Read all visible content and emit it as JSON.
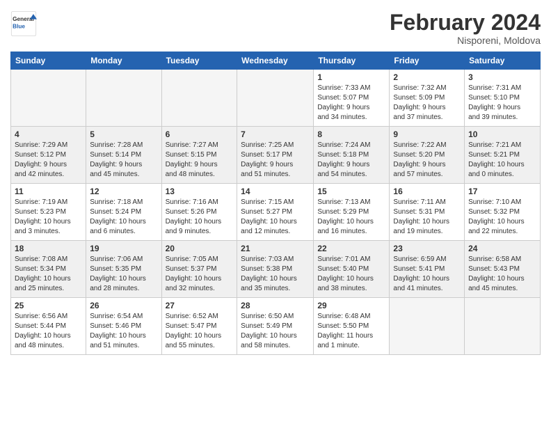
{
  "logo": {
    "text_general": "General",
    "text_blue": "Blue"
  },
  "title": "February 2024",
  "subtitle": "Nisporeni, Moldova",
  "weekdays": [
    "Sunday",
    "Monday",
    "Tuesday",
    "Wednesday",
    "Thursday",
    "Friday",
    "Saturday"
  ],
  "weeks": [
    [
      {
        "day": "",
        "info": ""
      },
      {
        "day": "",
        "info": ""
      },
      {
        "day": "",
        "info": ""
      },
      {
        "day": "",
        "info": ""
      },
      {
        "day": "1",
        "info": "Sunrise: 7:33 AM\nSunset: 5:07 PM\nDaylight: 9 hours\nand 34 minutes."
      },
      {
        "day": "2",
        "info": "Sunrise: 7:32 AM\nSunset: 5:09 PM\nDaylight: 9 hours\nand 37 minutes."
      },
      {
        "day": "3",
        "info": "Sunrise: 7:31 AM\nSunset: 5:10 PM\nDaylight: 9 hours\nand 39 minutes."
      }
    ],
    [
      {
        "day": "4",
        "info": "Sunrise: 7:29 AM\nSunset: 5:12 PM\nDaylight: 9 hours\nand 42 minutes."
      },
      {
        "day": "5",
        "info": "Sunrise: 7:28 AM\nSunset: 5:14 PM\nDaylight: 9 hours\nand 45 minutes."
      },
      {
        "day": "6",
        "info": "Sunrise: 7:27 AM\nSunset: 5:15 PM\nDaylight: 9 hours\nand 48 minutes."
      },
      {
        "day": "7",
        "info": "Sunrise: 7:25 AM\nSunset: 5:17 PM\nDaylight: 9 hours\nand 51 minutes."
      },
      {
        "day": "8",
        "info": "Sunrise: 7:24 AM\nSunset: 5:18 PM\nDaylight: 9 hours\nand 54 minutes."
      },
      {
        "day": "9",
        "info": "Sunrise: 7:22 AM\nSunset: 5:20 PM\nDaylight: 9 hours\nand 57 minutes."
      },
      {
        "day": "10",
        "info": "Sunrise: 7:21 AM\nSunset: 5:21 PM\nDaylight: 10 hours\nand 0 minutes."
      }
    ],
    [
      {
        "day": "11",
        "info": "Sunrise: 7:19 AM\nSunset: 5:23 PM\nDaylight: 10 hours\nand 3 minutes."
      },
      {
        "day": "12",
        "info": "Sunrise: 7:18 AM\nSunset: 5:24 PM\nDaylight: 10 hours\nand 6 minutes."
      },
      {
        "day": "13",
        "info": "Sunrise: 7:16 AM\nSunset: 5:26 PM\nDaylight: 10 hours\nand 9 minutes."
      },
      {
        "day": "14",
        "info": "Sunrise: 7:15 AM\nSunset: 5:27 PM\nDaylight: 10 hours\nand 12 minutes."
      },
      {
        "day": "15",
        "info": "Sunrise: 7:13 AM\nSunset: 5:29 PM\nDaylight: 10 hours\nand 16 minutes."
      },
      {
        "day": "16",
        "info": "Sunrise: 7:11 AM\nSunset: 5:31 PM\nDaylight: 10 hours\nand 19 minutes."
      },
      {
        "day": "17",
        "info": "Sunrise: 7:10 AM\nSunset: 5:32 PM\nDaylight: 10 hours\nand 22 minutes."
      }
    ],
    [
      {
        "day": "18",
        "info": "Sunrise: 7:08 AM\nSunset: 5:34 PM\nDaylight: 10 hours\nand 25 minutes."
      },
      {
        "day": "19",
        "info": "Sunrise: 7:06 AM\nSunset: 5:35 PM\nDaylight: 10 hours\nand 28 minutes."
      },
      {
        "day": "20",
        "info": "Sunrise: 7:05 AM\nSunset: 5:37 PM\nDaylight: 10 hours\nand 32 minutes."
      },
      {
        "day": "21",
        "info": "Sunrise: 7:03 AM\nSunset: 5:38 PM\nDaylight: 10 hours\nand 35 minutes."
      },
      {
        "day": "22",
        "info": "Sunrise: 7:01 AM\nSunset: 5:40 PM\nDaylight: 10 hours\nand 38 minutes."
      },
      {
        "day": "23",
        "info": "Sunrise: 6:59 AM\nSunset: 5:41 PM\nDaylight: 10 hours\nand 41 minutes."
      },
      {
        "day": "24",
        "info": "Sunrise: 6:58 AM\nSunset: 5:43 PM\nDaylight: 10 hours\nand 45 minutes."
      }
    ],
    [
      {
        "day": "25",
        "info": "Sunrise: 6:56 AM\nSunset: 5:44 PM\nDaylight: 10 hours\nand 48 minutes."
      },
      {
        "day": "26",
        "info": "Sunrise: 6:54 AM\nSunset: 5:46 PM\nDaylight: 10 hours\nand 51 minutes."
      },
      {
        "day": "27",
        "info": "Sunrise: 6:52 AM\nSunset: 5:47 PM\nDaylight: 10 hours\nand 55 minutes."
      },
      {
        "day": "28",
        "info": "Sunrise: 6:50 AM\nSunset: 5:49 PM\nDaylight: 10 hours\nand 58 minutes."
      },
      {
        "day": "29",
        "info": "Sunrise: 6:48 AM\nSunset: 5:50 PM\nDaylight: 11 hours\nand 1 minute."
      },
      {
        "day": "",
        "info": ""
      },
      {
        "day": "",
        "info": ""
      }
    ]
  ]
}
